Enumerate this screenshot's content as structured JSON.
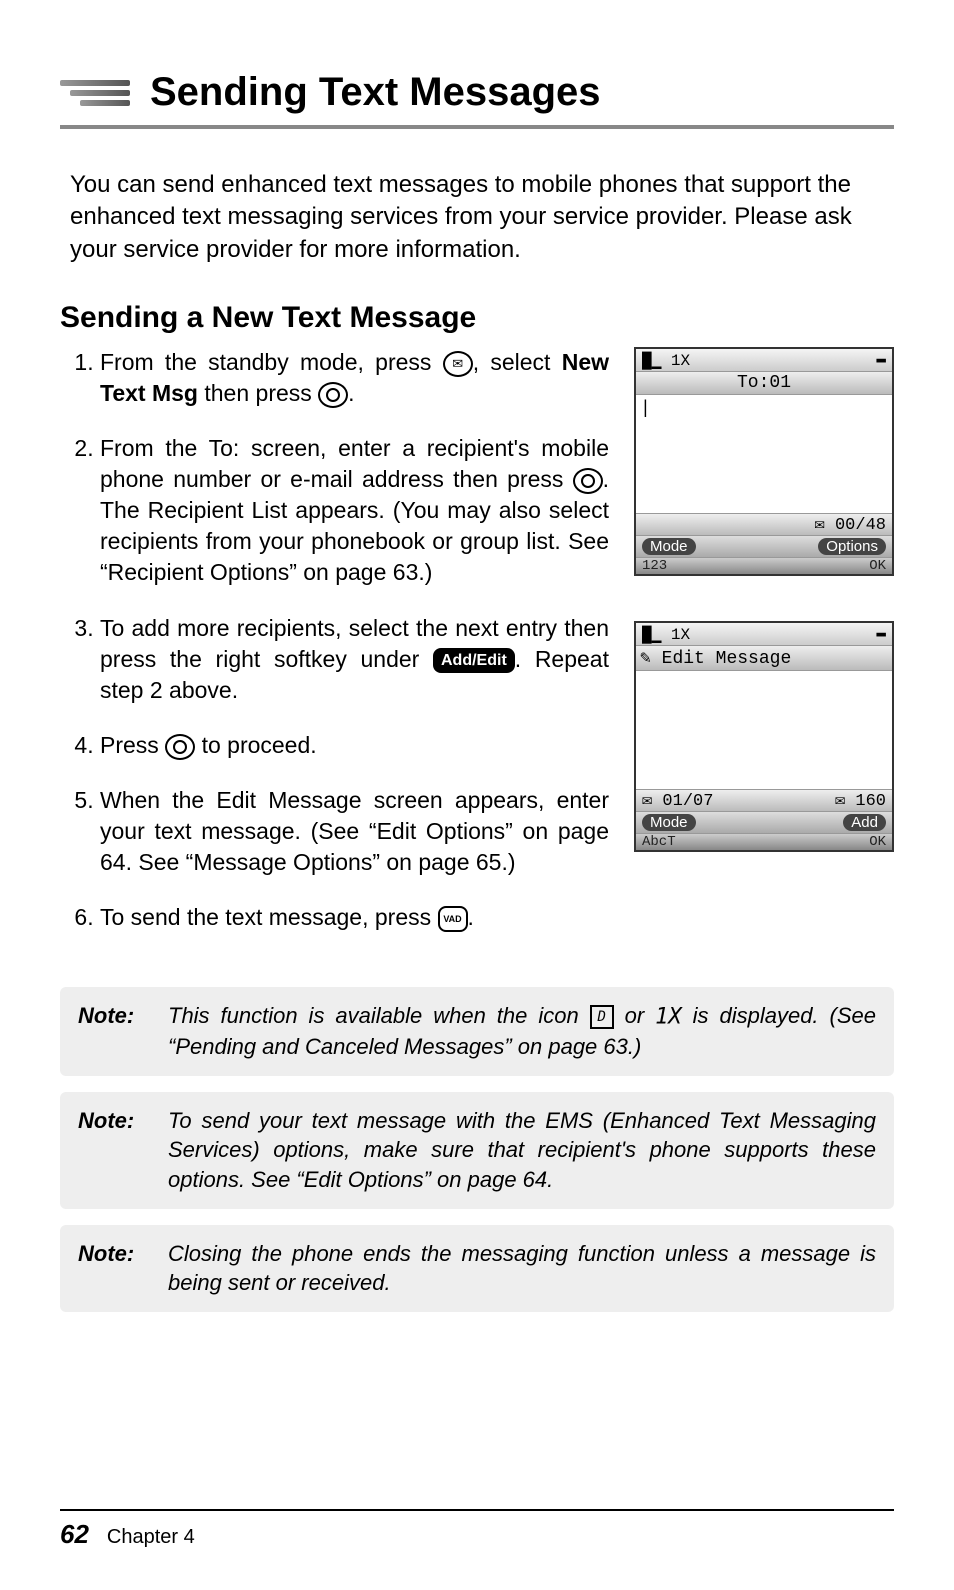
{
  "header": {
    "title": "Sending Text Messages"
  },
  "intro": "You can send enhanced text messages to mobile phones that support the enhanced text messaging services from your service provider. Please ask your service provider for more information.",
  "section_title": "Sending a New Text Message",
  "steps": {
    "s1a": "From the standby mode, press ",
    "s1b": ", select ",
    "s1c": "New Text Msg",
    "s1d": " then press ",
    "s1e": ".",
    "s2a": "From the To: screen, enter a recipient's mobile phone number or e-mail address then press ",
    "s2b": ". The Recipient List appears. (You may also select recipients from your phonebook or group list. See “Recipient Options” on page 63.)",
    "s3a": "To add more recipients, select the next entry then press the right softkey under ",
    "s3b": ". Repeat step 2 above.",
    "s4a": "Press ",
    "s4b": " to proceed.",
    "s5": "When the Edit Message screen appears, enter your text message. (See “Edit Options” on page 64. See “Message Options” on page 65.)",
    "s6a": "To send the text message, press ",
    "s6b": ".",
    "add_edit_label": "Add/Edit",
    "vad_label": "VAD"
  },
  "phone1": {
    "signal": "█▁ 1X",
    "batt": "▬",
    "title": "To:01",
    "body_cursor": "|",
    "counter": "✉ 00/48",
    "left_soft": "Mode",
    "right_soft": "Options",
    "bottom_left": "123",
    "bottom_right": "OK"
  },
  "phone2": {
    "signal": "█▁ 1X",
    "batt": "▬",
    "title": "✎ Edit Message",
    "counter_left": "✉ 01/07",
    "counter_right": "✉ 160",
    "left_soft": "Mode",
    "right_soft": "Add",
    "bottom_left": "AbcT",
    "bottom_right": "OK"
  },
  "notes": [
    {
      "label": "Note:",
      "pre": "This function is available when the icon ",
      "mid": " or ",
      "post": " is displayed. (See “Pending and Canceled Messages” on page 63.)",
      "icon1": "D",
      "icon2": "1X"
    },
    {
      "label": "Note:",
      "full": "To send your text message with the EMS (Enhanced Text Messaging Services) options, make sure that recipient's phone supports these options. See “Edit Options” on page 64."
    },
    {
      "label": "Note:",
      "full": "Closing the phone ends the messaging function unless a message is being sent or received."
    }
  ],
  "footer": {
    "page": "62",
    "chapter": "Chapter 4"
  }
}
